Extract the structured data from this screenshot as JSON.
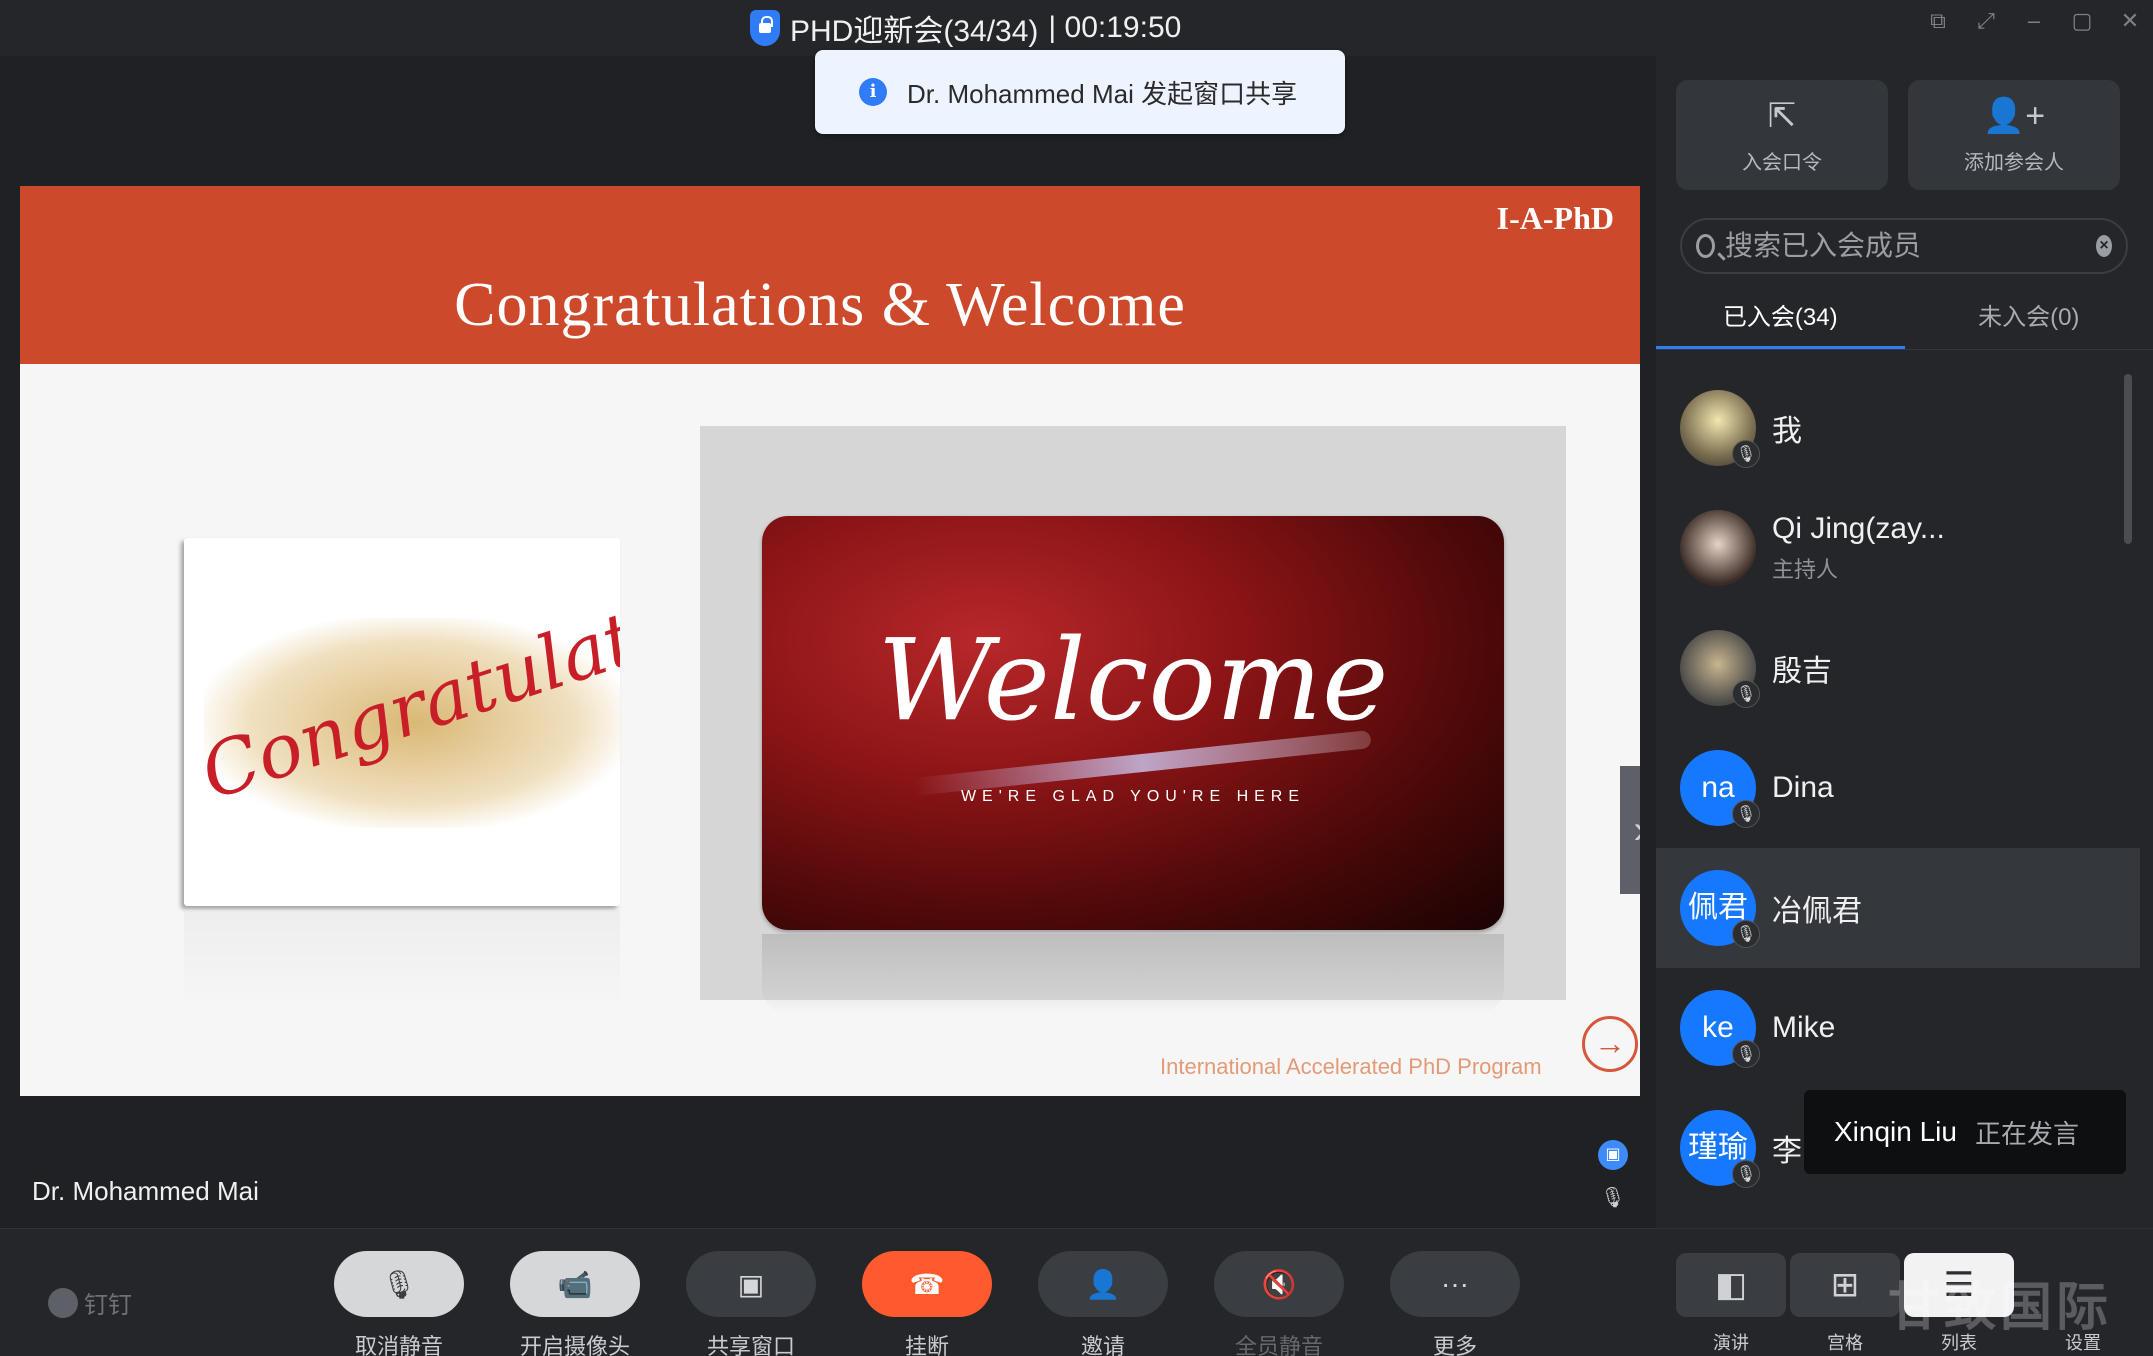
{
  "window": {
    "title": "PHD迎新会(34/34)",
    "timer": "| 00:19:50"
  },
  "toast": {
    "message": "Dr. Mohammed Mai 发起窗口共享"
  },
  "slide": {
    "tag": "I-A-PhD",
    "title": "Congratulations & Welcome",
    "card_left_text": "Congratulations",
    "card_right_text": "Welcome",
    "card_right_sub": "WE'RE GLAD YOU'RE HERE",
    "footer": "International Accelerated PhD Program"
  },
  "stage": {
    "speaker_name": "Dr. Mohammed Mai"
  },
  "panel": {
    "btn_join_code": "入会口令",
    "btn_add_member": "添加参会人",
    "search_placeholder": "搜索已入会成员",
    "tab_joined": "已入会(34)",
    "tab_not_joined": "未入会(0)",
    "members": [
      {
        "name": "我",
        "role": "",
        "avatar": ""
      },
      {
        "name": "Qi Jing(zay...",
        "role": "主持人",
        "avatar": ""
      },
      {
        "name": "殷吉",
        "role": "",
        "avatar": ""
      },
      {
        "name": "Dina",
        "role": "",
        "avatar": "na"
      },
      {
        "name": "冶佩君",
        "role": "",
        "avatar": "佩君"
      },
      {
        "name": "Mike",
        "role": "",
        "avatar": "ke"
      },
      {
        "name": "李",
        "role": "",
        "avatar": "瑾瑜"
      }
    ],
    "speaking_name": "Xinqin Liu",
    "speaking_status": "正在发言"
  },
  "toolbar": {
    "brand": "钉钉",
    "unmute": "取消静音",
    "camera": "开启摄像头",
    "share": "共享窗口",
    "hangup": "挂断",
    "invite": "邀请",
    "mute_all": "全员静音",
    "more": "更多",
    "view_speaker": "演讲",
    "view_grid": "宫格",
    "view_list": "列表",
    "settings": "设置",
    "watermark": "甘致国际"
  },
  "colors": {
    "accent": "#2f7cf6",
    "hangup": "#ff5a2d",
    "banner": "#cc4a2b"
  }
}
